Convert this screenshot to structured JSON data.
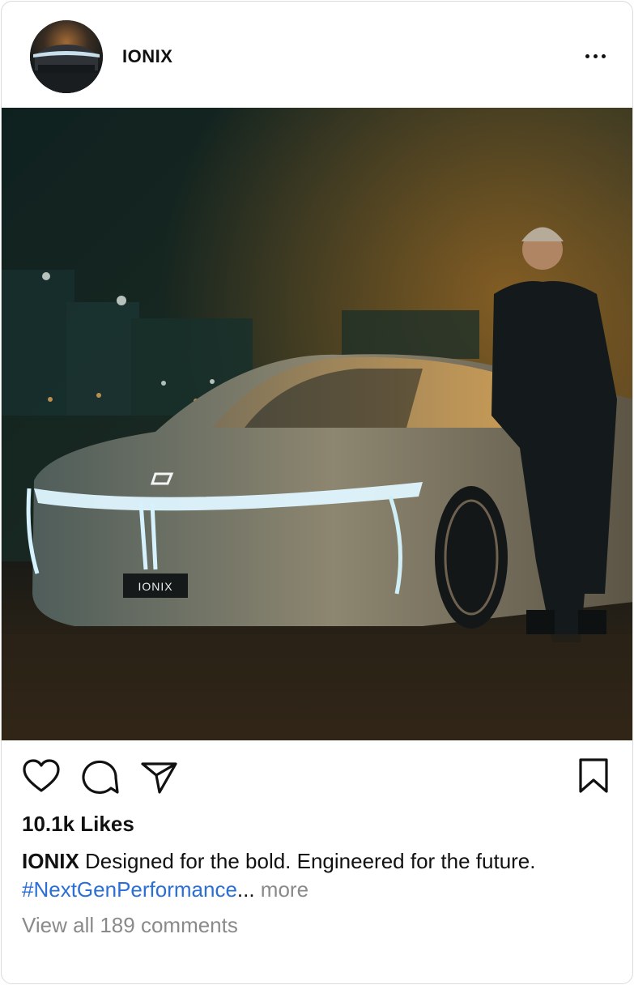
{
  "post": {
    "username": "IONIX",
    "more_icon": "ellipsis-horizontal-icon",
    "image_badge": "IONIX",
    "actions": {
      "like_icon": "heart-icon",
      "comment_icon": "comment-bubble-icon",
      "share_icon": "paper-plane-icon",
      "save_icon": "bookmark-icon"
    },
    "likes": "10.1k Likes",
    "caption": {
      "user": "IONIX",
      "text": " Designed for the bold. Engineered for the future. ",
      "hashtag": "#NextGenPerformance",
      "ellipsis": "...",
      "more": " more"
    },
    "comments_link": "View all 189 comments"
  },
  "colors": {
    "hashtag": "#2b6fd6",
    "muted": "#8a8a8a",
    "text": "#111111",
    "border": "#dbdbdb"
  }
}
